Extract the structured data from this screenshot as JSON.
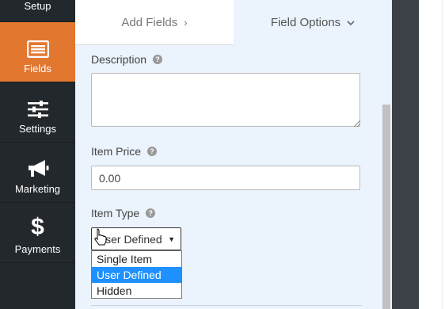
{
  "sidebar": {
    "items": [
      {
        "label": "Setup",
        "icon": "setup-icon"
      },
      {
        "label": "Fields",
        "icon": "fields-list-icon",
        "active": true
      },
      {
        "label": "Settings",
        "icon": "sliders-icon"
      },
      {
        "label": "Marketing",
        "icon": "megaphone-icon"
      },
      {
        "label": "Payments",
        "icon": "dollar-icon"
      }
    ],
    "accent_color": "#e27730"
  },
  "tabs": {
    "add_fields": "Add Fields",
    "field_options": "Field Options"
  },
  "form": {
    "description_label": "Description",
    "description_value": "",
    "item_price_label": "Item Price",
    "item_price_value": "0.00",
    "item_type_label": "Item Type",
    "item_type_selected": "User Defined",
    "item_type_options": [
      "Single Item",
      "User Defined",
      "Hidden"
    ],
    "help_glyph": "?"
  }
}
